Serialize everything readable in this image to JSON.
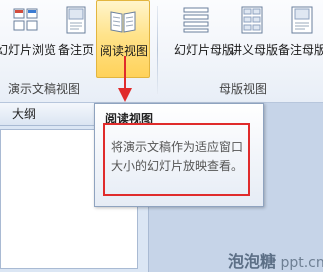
{
  "ribbon": {
    "presentation_views": {
      "group_label": "演示文稿视图",
      "buttons": [
        {
          "label": "幻灯片浏览",
          "icon": "slide-sorter-icon"
        },
        {
          "label": "备注页",
          "icon": "notes-page-icon"
        },
        {
          "label": "阅读视图",
          "icon": "reading-view-icon",
          "active": true
        }
      ]
    },
    "master_views": {
      "group_label": "母版视图",
      "buttons": [
        {
          "label": "幻灯片母版",
          "icon": "slide-master-icon"
        },
        {
          "label": "讲义母版",
          "icon": "handout-master-icon"
        },
        {
          "label": "备注母版",
          "icon": "notes-master-icon"
        }
      ]
    }
  },
  "pane": {
    "tab_label": "大纲"
  },
  "tooltip": {
    "title": "阅读视图",
    "body": "将演示文稿作为适应窗口大小的幻灯片放映查看。"
  },
  "watermark": {
    "brand": "泡泡糖",
    "site": "ppt.cn"
  },
  "colors": {
    "highlight_box": "#e02b2b",
    "active_button": "#ffd25a"
  }
}
